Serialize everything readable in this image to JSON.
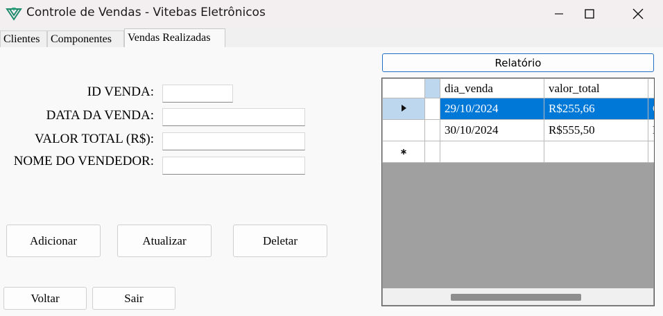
{
  "window": {
    "title": "Controle de Vendas - Vitebas Eletrônicos",
    "icon": "app-logo-icon",
    "controls": [
      "minimize-icon",
      "maximize-icon",
      "close-icon"
    ]
  },
  "tabs": [
    {
      "label": "Clientes"
    },
    {
      "label": "Componentes"
    },
    {
      "label": "Vendas Realizadas",
      "active": true
    }
  ],
  "form": {
    "id_label": "ID VENDA:",
    "date_label": "DATA DA VENDA:",
    "total_label": "VALOR TOTAL (R$):",
    "seller_label": "NOME DO VENDEDOR:",
    "id_value": "",
    "date_value": "",
    "total_value": "",
    "seller_value": ""
  },
  "buttons": {
    "add": "Adicionar",
    "update": "Atualizar",
    "delete": "Deletar",
    "back": "Voltar",
    "exit": "Sair",
    "report": "Relatório"
  },
  "grid": {
    "columns": [
      "dia_venda",
      "valor_total"
    ],
    "rows": [
      {
        "dia_venda": "29/10/2024",
        "valor_total": "R$255,66",
        "next": "C",
        "selected": true
      },
      {
        "dia_venda": "30/10/2024",
        "valor_total": "R$555,50",
        "next": "E",
        "selected": false
      }
    ]
  }
}
